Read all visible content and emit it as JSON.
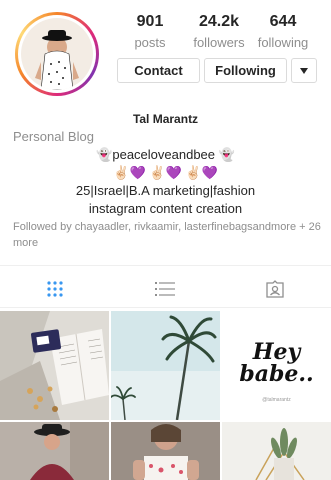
{
  "profile": {
    "name": "Tal Marantz",
    "category": "Personal Blog",
    "bio_lines": [
      "👻peaceloveandbee 👻",
      "✌🏻💜 ✌🏻💜 ✌🏻💜",
      "25|Israel|B.A marketing|fashion",
      "instagram content creation"
    ],
    "followed_by": "Followed by chayaadler, rivkaamir, lasterfinebagsandmore + 26 more"
  },
  "stats": [
    {
      "value": "901",
      "label": "posts"
    },
    {
      "value": "24.2k",
      "label": "followers"
    },
    {
      "value": "644",
      "label": "following"
    }
  ],
  "actions": {
    "contact": "Contact",
    "following": "Following",
    "more_icon": "caret-down-icon"
  },
  "tabs": [
    {
      "icon": "grid-icon"
    },
    {
      "icon": "list-icon"
    },
    {
      "icon": "tagged-icon"
    }
  ],
  "posts": [
    {
      "text": ""
    },
    {
      "text": ""
    },
    {
      "text": "Hey babe..",
      "caption": "@talmarantz"
    },
    {
      "text": ""
    },
    {
      "text": ""
    },
    {
      "text": ""
    }
  ],
  "colors": {
    "accent_blue": "#3897f0",
    "gray_text": "#8e8e8e",
    "border": "#dbdbdb",
    "ring_start": "#f58529",
    "ring_mid": "#dd2a7b",
    "ring_end": "#8134af"
  }
}
